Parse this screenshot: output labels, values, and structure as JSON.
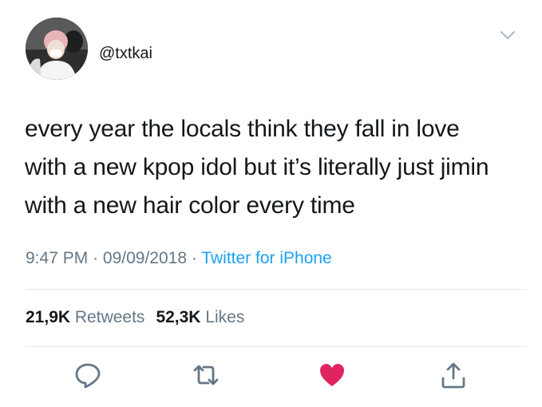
{
  "tweet": {
    "handle": "@txtkai",
    "avatar": "profile-photo",
    "text_lines": [
      "every year the locals think they fall in love",
      "with a new kpop idol but it’s literally just jimin",
      "with a new hair color every time"
    ],
    "time": "9:47 PM",
    "date": "09/09/2018",
    "separator": "·",
    "source": "Twitter for iPhone",
    "retweets_count": "21,9K",
    "retweets_label": "Retweets",
    "likes_count": "52,3K",
    "likes_label": "Likes"
  },
  "icons": {
    "menu": "chevron-down-icon",
    "reply": "reply-icon",
    "retweet": "retweet-icon",
    "like": "heart-icon",
    "share": "share-icon"
  },
  "colors": {
    "text": "#14171a",
    "secondary": "#657786",
    "link": "#1da1f2",
    "like": "#e0245e",
    "divider": "#e1e8ed"
  }
}
